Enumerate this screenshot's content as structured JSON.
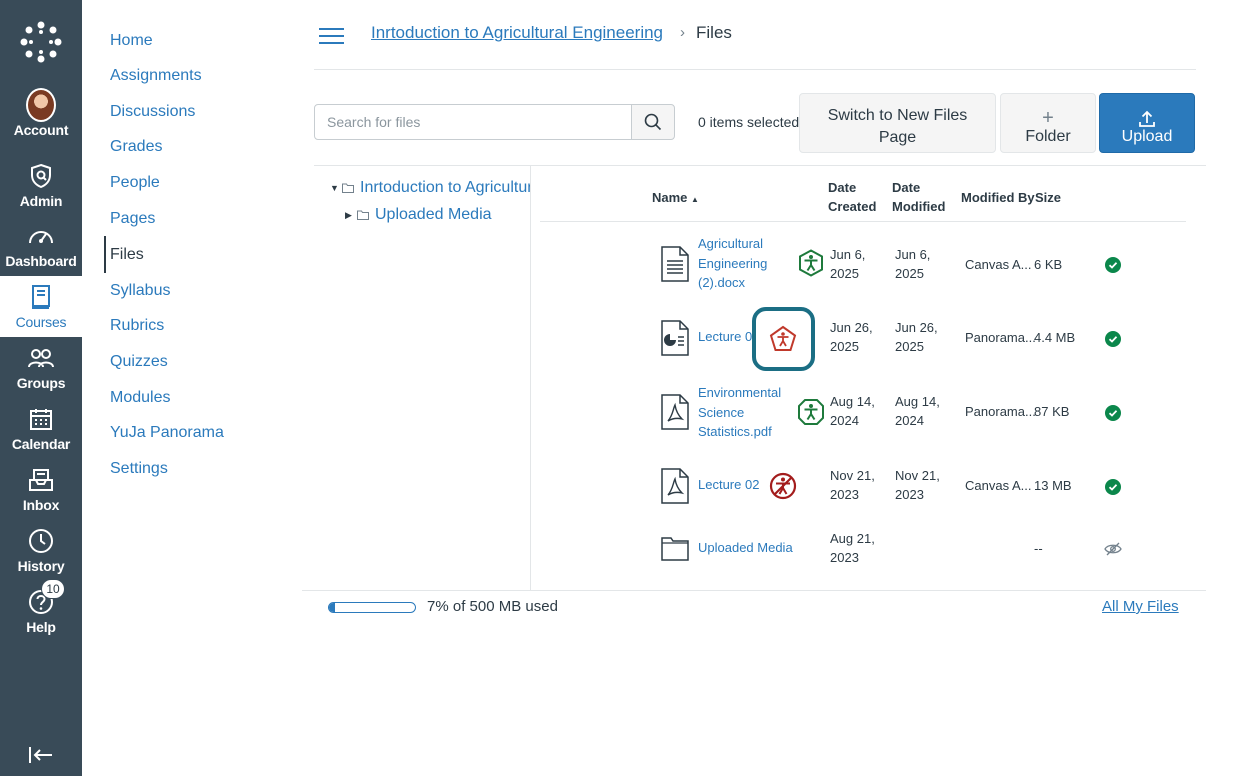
{
  "global_nav": {
    "items": [
      {
        "label": "Account",
        "icon": "avatar"
      },
      {
        "label": "Admin",
        "icon": "shield-icon"
      },
      {
        "label": "Dashboard",
        "icon": "speedometer-icon"
      },
      {
        "label": "Courses",
        "icon": "book-icon",
        "active": true
      },
      {
        "label": "Groups",
        "icon": "people-icon"
      },
      {
        "label": "Calendar",
        "icon": "calendar-icon"
      },
      {
        "label": "Inbox",
        "icon": "inbox-icon"
      },
      {
        "label": "History",
        "icon": "clock-icon"
      },
      {
        "label": "Help",
        "icon": "question-icon"
      }
    ],
    "help_badge": "10"
  },
  "course_nav": {
    "items": [
      "Home",
      "Assignments",
      "Discussions",
      "Grades",
      "People",
      "Pages",
      "Files",
      "Syllabus",
      "Rubrics",
      "Quizzes",
      "Modules",
      "YuJa Panorama",
      "Settings"
    ],
    "active": "Files"
  },
  "breadcrumb": {
    "course": "Inrtoduction to Agricultural Engineering",
    "separator": "›",
    "current": "Files"
  },
  "toolbar": {
    "search_placeholder": "Search for files",
    "selected_count": "0 items selected",
    "switch_label_1": "Switch to New Files",
    "switch_label_2": "Page",
    "folder_label": "Folder",
    "upload_label": "Upload"
  },
  "tree": {
    "root": "Inrtoduction to Agricultural Engineering",
    "child": "Uploaded Media"
  },
  "table": {
    "headers": {
      "name": "Name",
      "created_1": "Date",
      "created_2": "Created",
      "modified_1": "Date",
      "modified_2": "Modified",
      "modified_by": "Modified By",
      "size": "Size"
    },
    "rows": [
      {
        "name_lines": [
          "Agricultural",
          "Engineering",
          "(2).docx"
        ],
        "type": "document",
        "a11y": "green",
        "created": [
          "Jun 6,",
          "2025"
        ],
        "modified": [
          "Jun 6,",
          "2025"
        ],
        "by": "Canvas A...",
        "size": "6 KB",
        "status": "published"
      },
      {
        "name_lines": [
          "Lecture 0"
        ],
        "type": "presentation",
        "a11y": "red",
        "created": [
          "Jun 26,",
          "2025"
        ],
        "modified": [
          "Jun 26,",
          "2025"
        ],
        "by": "Panorama...",
        "size": "4.4 MB",
        "status": "published"
      },
      {
        "name_lines": [
          "Environmental",
          "Science",
          "Statistics.pdf"
        ],
        "type": "pdf",
        "a11y": "green",
        "created": [
          "Aug 14,",
          "2024"
        ],
        "modified": [
          "Aug 14,",
          "2024"
        ],
        "by": "Panorama...",
        "size": "87 KB",
        "status": "published"
      },
      {
        "name_lines": [
          "Lecture 02"
        ],
        "type": "pdf",
        "a11y": "red-crossed",
        "created": [
          "Nov 21,",
          "2023"
        ],
        "modified": [
          "Nov 21,",
          "2023"
        ],
        "by": "Canvas A...",
        "size": "13 MB",
        "status": "published"
      },
      {
        "name_lines": [
          "Uploaded Media"
        ],
        "type": "folder",
        "created": [
          "Aug 21,",
          "2023"
        ],
        "modified": [
          "",
          ""
        ],
        "by": "",
        "size": "--",
        "status": "hidden"
      }
    ]
  },
  "footer": {
    "quota_percent": 7,
    "quota_text": "7% of 500 MB used",
    "all_files": "All My Files"
  },
  "colors": {
    "nav_bg": "#394b58",
    "link": "#2b7abc",
    "accessible_green": "#1e7a3c",
    "inaccessible_red": "#c0392b",
    "highlight": "#1b6e84",
    "published_green": "#0b874b"
  }
}
